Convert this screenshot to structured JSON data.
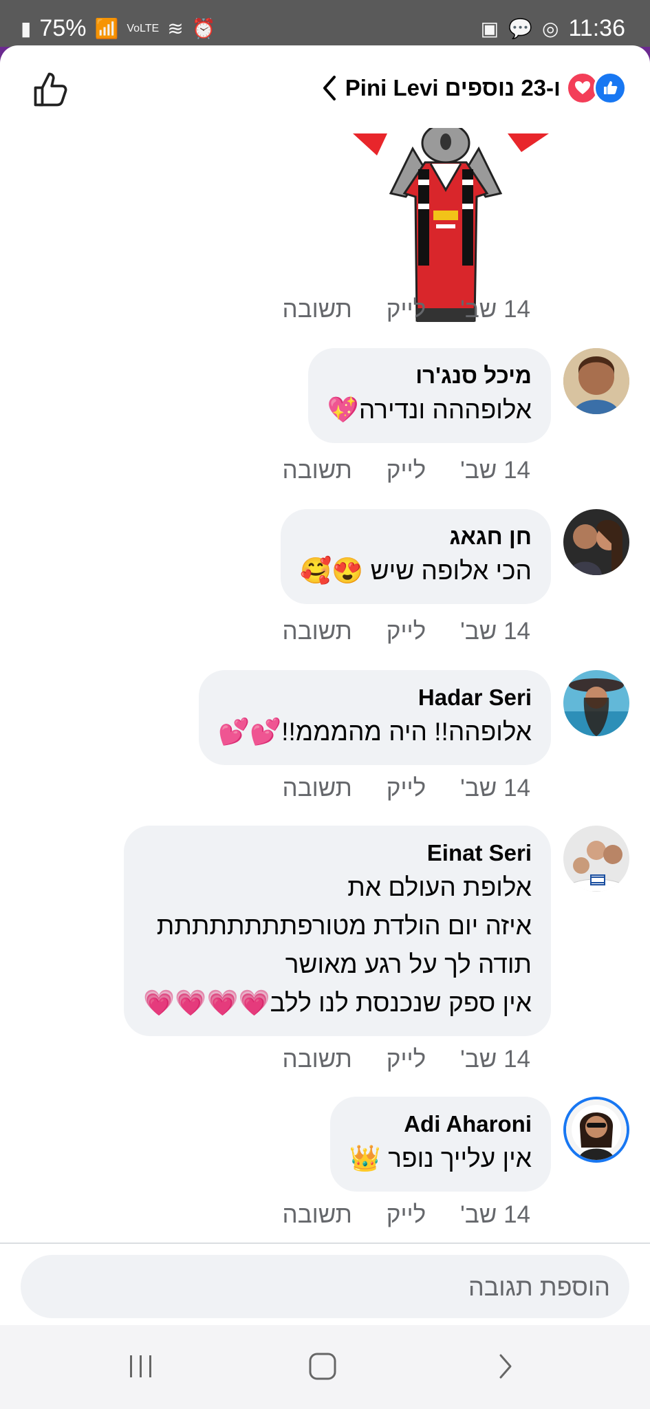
{
  "status_bar": {
    "battery": "75%",
    "signal_label": "VoLTE",
    "time": "11:36"
  },
  "header": {
    "title": "Pini Levi ו-23 נוספים"
  },
  "comments": [
    {
      "name": "מיכל סנג'רו",
      "text": "אלופההה ונדירה💖",
      "date": "14 שב'",
      "like": "לייק",
      "reply": "תשובה"
    },
    {
      "name": "חן חגאג",
      "text": "הכי אלופה שיש 😍🥰",
      "date": "14 שב'",
      "like": "לייק",
      "reply": "תשובה"
    },
    {
      "name": "Hadar Seri",
      "text": "אלופהה!! היה מהמממ!!💕💕",
      "date": "14 שב'",
      "like": "לייק",
      "reply": "תשובה"
    },
    {
      "name": "Einat Seri",
      "text": "אלופת העולם את\nאיזה יום הולדת מטורפתתתתתתתת\nתודה לך על רגע מאושר\nאין ספק שנכנסת לנו ללב💗💗💗💗",
      "date": "14 שב'",
      "like": "לייק",
      "reply": "תשובה"
    },
    {
      "name": "Adi Aharoni",
      "text": "אין עלייך נופר 👑",
      "date": "14 שב'",
      "like": "לייק",
      "reply": "תשובה"
    }
  ],
  "sticker_meta": {
    "date": "14 שב'",
    "like": "לייק",
    "reply": "תשובה"
  },
  "composer": {
    "placeholder": "הוספת תגובה"
  },
  "colors": {
    "brand": "#1877f2",
    "love": "#f33e58",
    "bubble": "#f0f2f5",
    "meta": "#65676b"
  }
}
